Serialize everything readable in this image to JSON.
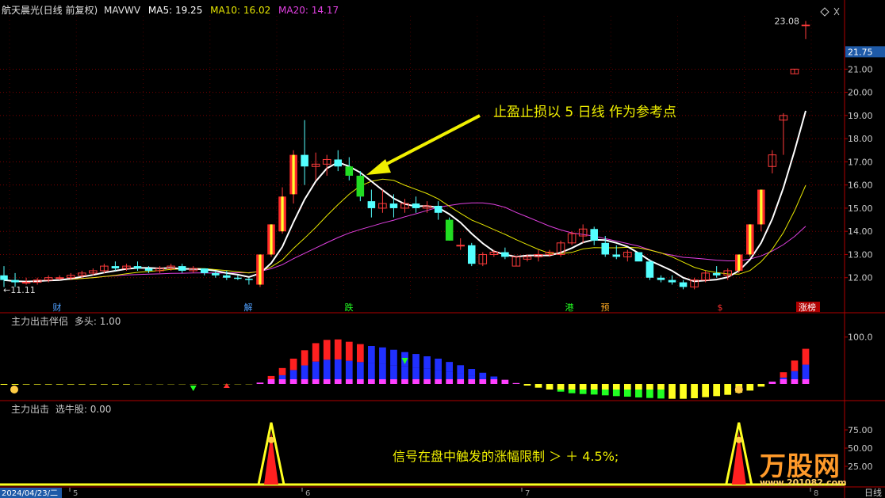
{
  "colors": {
    "bg": "#000000",
    "up": "#ff3b3b",
    "down": "#54ffff",
    "ma5": "#ffffff",
    "ma10": "#e6e600",
    "ma20": "#e040e0",
    "axis": "#a0a0a0",
    "grid": "#7a0000",
    "annotation": "#f0f000"
  },
  "header": {
    "stock_name": "航天晨光(日线 前复权)",
    "indicator_name": "MAVWV",
    "ma5": "MA5: 19.25",
    "ma10": "MA10: 16.02",
    "ma20": "MA20: 14.17"
  },
  "sub1_header": {
    "name": "主力出击伴侣",
    "param": "多头: 1.00"
  },
  "sub2_header": {
    "name": "主力出击",
    "param": "选牛股: 0.00"
  },
  "annotation_main": "止盈止损以 5 日线 作为参考点",
  "annotation_bottom": "信号在盘中触发的涨幅限制 ＞ ＋ 4.5%;",
  "watermark": {
    "brand": "万股网",
    "url": "www.201082.com"
  },
  "price_axis": {
    "labels": [
      "21.00",
      "20.00",
      "19.00",
      "18.00",
      "17.00",
      "16.00",
      "15.00",
      "14.00",
      "13.00",
      "12.00"
    ],
    "current_price": "21.75",
    "high_label": "23.08",
    "low_label": "11.11"
  },
  "sub1_axis": [
    "100.0"
  ],
  "sub2_axis": [
    "75.00",
    "50.00",
    "25.00"
  ],
  "date_axis": {
    "start_date": "2024/04/23/二",
    "months": [
      "5",
      "6",
      "7",
      "8"
    ],
    "timeframe": "日线"
  },
  "event_markers": [
    "财",
    "解",
    "跌",
    "港",
    "预",
    "$",
    "涨榜"
  ],
  "chart_data": [
    {
      "type": "candlestick",
      "title": "航天晨光(日线 前复权)",
      "ylim": [
        11.0,
        23.3
      ],
      "series": [
        {
          "name": "MA5",
          "value": 19.25
        },
        {
          "name": "MA10",
          "value": 16.02
        },
        {
          "name": "MA20",
          "value": 14.17
        }
      ],
      "candles": [
        [
          12.1,
          12.5,
          11.6,
          11.9
        ],
        [
          11.9,
          12.2,
          11.6,
          11.8
        ],
        [
          11.8,
          12.0,
          11.7,
          11.8
        ],
        [
          11.8,
          12.0,
          11.7,
          11.9
        ],
        [
          11.9,
          12.1,
          11.8,
          12.0
        ],
        [
          12.0,
          12.1,
          11.9,
          12.0
        ],
        [
          12.0,
          12.2,
          11.9,
          12.1
        ],
        [
          12.1,
          12.3,
          12.0,
          12.2
        ],
        [
          12.2,
          12.4,
          12.1,
          12.3
        ],
        [
          12.3,
          12.6,
          12.2,
          12.5
        ],
        [
          12.5,
          12.7,
          12.3,
          12.4
        ],
        [
          12.4,
          12.6,
          12.3,
          12.5
        ],
        [
          12.5,
          12.7,
          12.3,
          12.4
        ],
        [
          12.4,
          12.5,
          12.2,
          12.3
        ],
        [
          12.3,
          12.5,
          12.2,
          12.4
        ],
        [
          12.4,
          12.6,
          12.3,
          12.5
        ],
        [
          12.5,
          12.6,
          12.2,
          12.3
        ],
        [
          12.3,
          12.5,
          12.2,
          12.4
        ],
        [
          12.4,
          12.4,
          12.1,
          12.2
        ],
        [
          12.2,
          12.3,
          12.0,
          12.1
        ],
        [
          12.1,
          12.3,
          11.9,
          12.0
        ],
        [
          12.0,
          12.1,
          11.9,
          11.95
        ],
        [
          11.95,
          12.0,
          11.7,
          11.9
        ],
        [
          11.7,
          13.0,
          11.6,
          13.0
        ],
        [
          13.0,
          14.3,
          12.9,
          14.3
        ],
        [
          14.0,
          15.9,
          13.9,
          15.5
        ],
        [
          15.6,
          17.5,
          15.2,
          17.3
        ],
        [
          17.3,
          18.8,
          16.0,
          16.8
        ],
        [
          16.8,
          17.4,
          16.2,
          16.9
        ],
        [
          16.9,
          17.3,
          16.4,
          17.1
        ],
        [
          17.1,
          17.5,
          16.6,
          16.8
        ],
        [
          16.8,
          17.2,
          16.2,
          16.4
        ],
        [
          16.4,
          16.6,
          15.3,
          15.5
        ],
        [
          15.3,
          15.8,
          14.6,
          15.0
        ],
        [
          15.0,
          15.8,
          14.8,
          15.2
        ],
        [
          15.2,
          15.6,
          14.6,
          15.0
        ],
        [
          15.0,
          15.4,
          14.8,
          15.2
        ],
        [
          15.2,
          15.5,
          14.8,
          15.0
        ],
        [
          15.0,
          15.3,
          14.8,
          15.1
        ],
        [
          15.1,
          15.3,
          14.5,
          14.8
        ],
        [
          14.5,
          14.6,
          13.6,
          13.6
        ],
        [
          13.4,
          13.7,
          13.2,
          13.4
        ],
        [
          13.4,
          13.5,
          12.5,
          12.6
        ],
        [
          12.6,
          13.1,
          12.5,
          13.0
        ],
        [
          13.0,
          13.2,
          12.9,
          13.1
        ],
        [
          13.1,
          13.3,
          12.8,
          12.9
        ],
        [
          12.5,
          12.9,
          12.5,
          12.9
        ],
        [
          12.8,
          13.0,
          12.7,
          12.9
        ],
        [
          12.9,
          13.2,
          12.7,
          13.0
        ],
        [
          13.0,
          13.2,
          12.9,
          13.1
        ],
        [
          13.0,
          13.6,
          12.9,
          13.5
        ],
        [
          13.5,
          14.0,
          13.4,
          13.9
        ],
        [
          13.8,
          14.3,
          13.5,
          14.1
        ],
        [
          14.1,
          14.2,
          13.4,
          13.6
        ],
        [
          13.5,
          13.8,
          12.9,
          13.0
        ],
        [
          13.0,
          13.4,
          12.8,
          12.9
        ],
        [
          12.9,
          13.2,
          12.7,
          13.1
        ],
        [
          13.1,
          13.1,
          12.8,
          12.7
        ],
        [
          12.7,
          12.8,
          11.9,
          12.0
        ],
        [
          12.0,
          12.1,
          11.8,
          11.9
        ],
        [
          11.9,
          12.1,
          11.7,
          11.8
        ],
        [
          11.8,
          11.9,
          11.5,
          11.6
        ],
        [
          11.6,
          12.0,
          11.5,
          11.9
        ],
        [
          11.9,
          12.3,
          11.8,
          12.2
        ],
        [
          12.2,
          12.5,
          12.0,
          12.1
        ],
        [
          12.1,
          12.4,
          11.9,
          12.3
        ],
        [
          12.3,
          13.0,
          12.2,
          13.0
        ],
        [
          13.0,
          14.3,
          12.9,
          14.3
        ],
        [
          14.3,
          15.8,
          14.0,
          15.8
        ],
        [
          16.8,
          17.5,
          16.5,
          17.3
        ],
        [
          18.8,
          19.1,
          17.3,
          19.0
        ],
        [
          20.8,
          21.0,
          20.8,
          21.0
        ],
        [
          22.9,
          23.08,
          22.3,
          22.9
        ]
      ]
    },
    {
      "type": "bar",
      "title": "主力出击伴侣",
      "ylim": [
        -60,
        135
      ],
      "series": [
        {
          "name": "bars",
          "values": [
            -3,
            -3,
            -2,
            -2,
            -2,
            -2,
            -2,
            -2,
            -2,
            -2,
            -2,
            -2,
            -1,
            -1,
            -1,
            -1,
            -1,
            -1,
            -1,
            -1,
            -1,
            -1,
            -1,
            3,
            17,
            34,
            54,
            72,
            87,
            94,
            95,
            90,
            85,
            81,
            78,
            73,
            68,
            64,
            59,
            54,
            47,
            40,
            32,
            24,
            16,
            9,
            2,
            -6,
            -14,
            -21,
            -29,
            -35,
            -38,
            -40,
            -43,
            -46,
            -48,
            -51,
            -53,
            -55,
            -56,
            -56,
            -54,
            -50,
            -46,
            -41,
            -33,
            -25,
            -10,
            5,
            25,
            50,
            75
          ]
        }
      ]
    },
    {
      "type": "area",
      "title": "主力出击",
      "ylim": [
        0,
        100
      ],
      "series": [
        {
          "name": "signal",
          "values": [
            0,
            0,
            0,
            0,
            0,
            0,
            0,
            0,
            0,
            0,
            0,
            0,
            0,
            0,
            0,
            0,
            0,
            0,
            0,
            0,
            0,
            0,
            0,
            0,
            0,
            0,
            0,
            0,
            0,
            0,
            0,
            0,
            0,
            0,
            0,
            0,
            0,
            0,
            0,
            0,
            0,
            0,
            0,
            0,
            0,
            0,
            0,
            0,
            0,
            0,
            0,
            0,
            0,
            0,
            0,
            0,
            0,
            0,
            0,
            0,
            0,
            0,
            0,
            0,
            0,
            0,
            0,
            0,
            0,
            0,
            0,
            0,
            0
          ]
        },
        {
          "name": "spikes",
          "values": [
            0,
            0,
            0,
            0,
            0,
            0,
            0,
            0,
            0,
            0,
            0,
            0,
            0,
            0,
            0,
            0,
            0,
            0,
            0,
            0,
            0,
            0,
            0,
            0,
            100,
            0,
            0,
            0,
            0,
            0,
            0,
            0,
            0,
            0,
            0,
            0,
            0,
            0,
            0,
            0,
            0,
            0,
            0,
            0,
            0,
            0,
            0,
            0,
            0,
            0,
            0,
            0,
            0,
            0,
            0,
            0,
            0,
            0,
            0,
            0,
            0,
            0,
            0,
            0,
            0,
            0,
            100,
            0,
            0,
            0,
            0,
            0,
            0
          ]
        }
      ]
    }
  ]
}
